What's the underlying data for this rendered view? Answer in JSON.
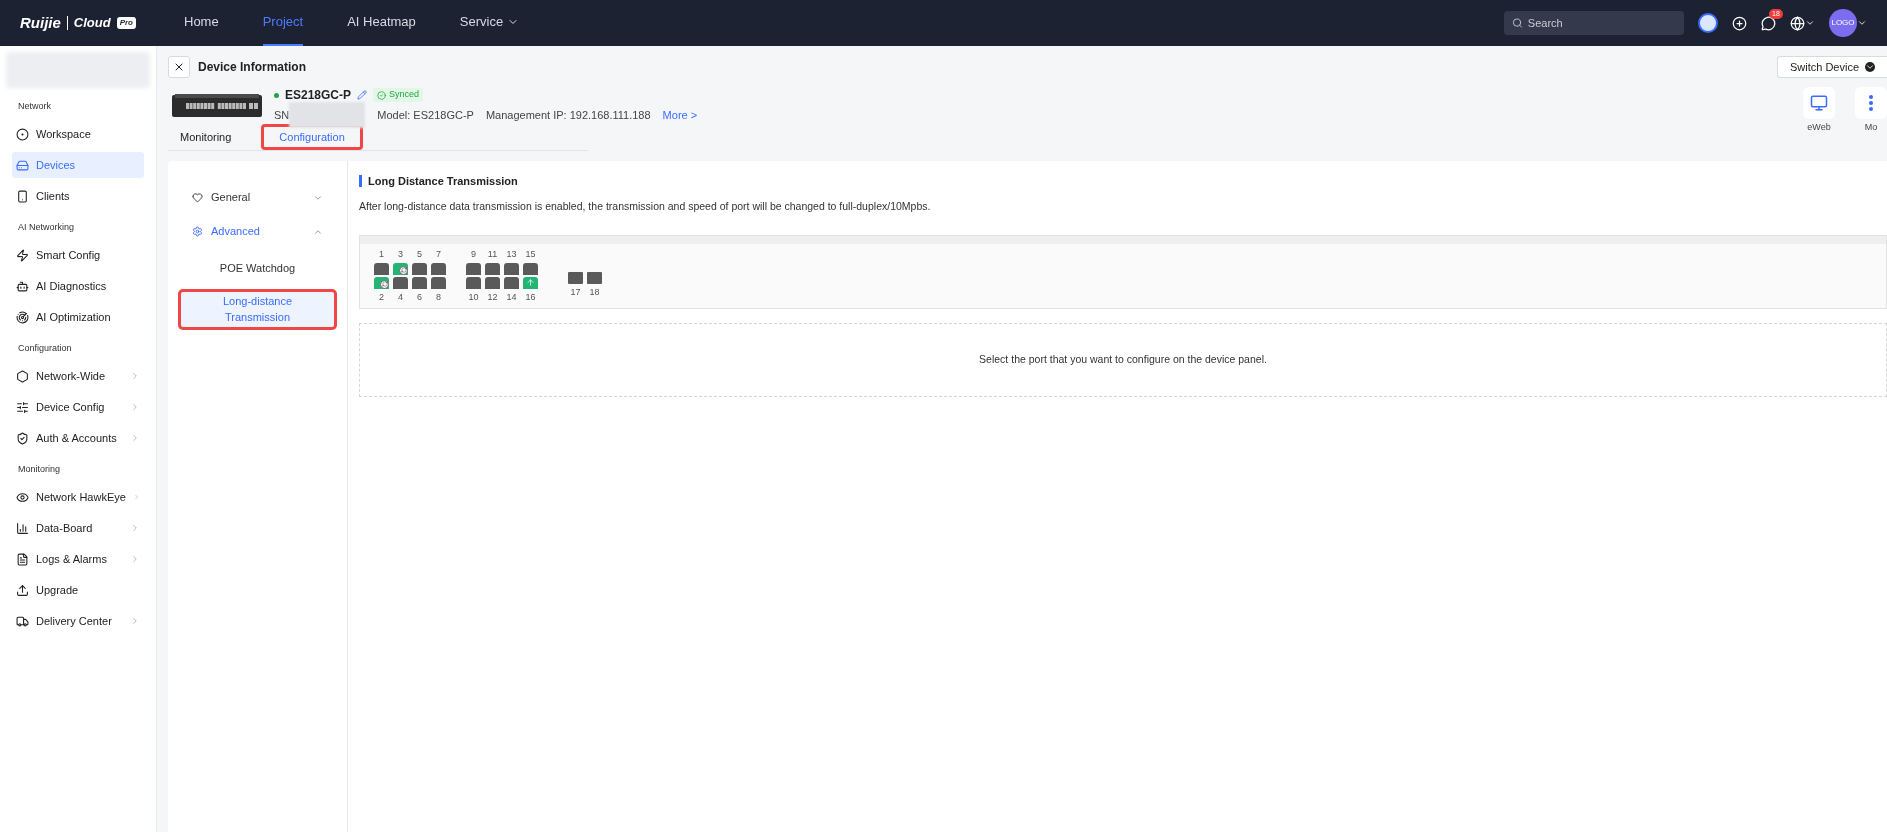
{
  "topbar": {
    "logo": "Ruijie",
    "logo_product": "Cloud",
    "logo_badge": "Pro",
    "nav": [
      {
        "label": "Home",
        "selected": false,
        "dropdown": false
      },
      {
        "label": "Project",
        "selected": true,
        "dropdown": false
      },
      {
        "label": "AI Heatmap",
        "selected": false,
        "dropdown": false
      },
      {
        "label": "Service",
        "selected": false,
        "dropdown": true
      }
    ],
    "search": {
      "placeholder": "Search"
    },
    "notification_count": "18",
    "avatar": "LOGO"
  },
  "sidebar": {
    "sections": [
      {
        "title": "Network",
        "items": [
          {
            "label": "Workspace",
            "selected": false,
            "expandable": false
          },
          {
            "label": "Devices",
            "selected": true,
            "expandable": false
          },
          {
            "label": "Clients",
            "selected": false,
            "expandable": false
          }
        ]
      },
      {
        "title": "AI Networking",
        "items": [
          {
            "label": "Smart Config",
            "selected": false,
            "expandable": false
          },
          {
            "label": "AI Diagnostics",
            "selected": false,
            "expandable": false
          },
          {
            "label": "AI Optimization",
            "selected": false,
            "expandable": false
          }
        ]
      },
      {
        "title": "Configuration",
        "items": [
          {
            "label": "Network-Wide",
            "selected": false,
            "expandable": true
          },
          {
            "label": "Device Config",
            "selected": false,
            "expandable": true
          },
          {
            "label": "Auth & Accounts",
            "selected": false,
            "expandable": true
          }
        ]
      },
      {
        "title": "Monitoring",
        "items": [
          {
            "label": "Network HawkEye",
            "selected": false,
            "expandable": true
          },
          {
            "label": "Data-Board",
            "selected": false,
            "expandable": true
          },
          {
            "label": "Logs & Alarms",
            "selected": false,
            "expandable": true
          },
          {
            "label": "Upgrade",
            "selected": false,
            "expandable": false
          },
          {
            "label": "Delivery Center",
            "selected": false,
            "expandable": true
          }
        ]
      }
    ]
  },
  "page": {
    "title": "Device Information",
    "switch_button": "Switch Device",
    "quick_actions": [
      {
        "label": "eWeb"
      },
      {
        "label": "Mo"
      }
    ]
  },
  "device": {
    "name": "ES218GC-P",
    "online": true,
    "status": "Synced",
    "sn_label": "SN",
    "model": "Model: ES218GC-P",
    "ip": "Management IP: 192.168.111.188",
    "more": "More >"
  },
  "tabs": [
    {
      "label": "Monitoring",
      "selected": false,
      "highlighted": false
    },
    {
      "label": "Configuration",
      "selected": true,
      "highlighted": true
    }
  ],
  "config_menu": [
    {
      "label": "General",
      "expanded": false,
      "selected": false
    },
    {
      "label": "Advanced",
      "expanded": true,
      "selected": true,
      "children": [
        {
          "label": "POE Watchdog",
          "selected": false,
          "highlighted": false
        },
        {
          "label": "Long-distance Transmission",
          "selected": true,
          "highlighted": true
        }
      ]
    }
  ],
  "section": {
    "title": "Long Distance Transmission",
    "description": "After long-distance data transmission is enabled, the transmission and speed of port will be changed to full-duplex/10Mpbs.",
    "empty_hint": "Select the port that you want to configure on the device panel."
  },
  "ports": [
    {
      "number": "1",
      "kind": "copper",
      "up": false,
      "loop": false,
      "uplink": false
    },
    {
      "number": "2",
      "kind": "copper",
      "up": true,
      "loop": true,
      "uplink": false
    },
    {
      "number": "3",
      "kind": "copper",
      "up": true,
      "loop": true,
      "uplink": false
    },
    {
      "number": "4",
      "kind": "copper",
      "up": false,
      "loop": false,
      "uplink": false
    },
    {
      "number": "5",
      "kind": "copper",
      "up": false,
      "loop": false,
      "uplink": false
    },
    {
      "number": "6",
      "kind": "copper",
      "up": false,
      "loop": false,
      "uplink": false
    },
    {
      "number": "7",
      "kind": "copper",
      "up": false,
      "loop": false,
      "uplink": false
    },
    {
      "number": "8",
      "kind": "copper",
      "up": false,
      "loop": false,
      "uplink": false
    },
    {
      "number": "9",
      "kind": "copper",
      "up": false,
      "loop": false,
      "uplink": false
    },
    {
      "number": "10",
      "kind": "copper",
      "up": false,
      "loop": false,
      "uplink": false
    },
    {
      "number": "11",
      "kind": "copper",
      "up": false,
      "loop": false,
      "uplink": false
    },
    {
      "number": "12",
      "kind": "copper",
      "up": false,
      "loop": false,
      "uplink": false
    },
    {
      "number": "13",
      "kind": "copper",
      "up": false,
      "loop": false,
      "uplink": false
    },
    {
      "number": "14",
      "kind": "copper",
      "up": false,
      "loop": false,
      "uplink": false
    },
    {
      "number": "15",
      "kind": "copper",
      "up": false,
      "loop": false,
      "uplink": false
    },
    {
      "number": "16",
      "kind": "copper",
      "up": true,
      "loop": false,
      "uplink": true
    },
    {
      "number": "17",
      "kind": "sfp",
      "up": false,
      "loop": false,
      "uplink": false
    },
    {
      "number": "18",
      "kind": "sfp",
      "up": false,
      "loop": false,
      "uplink": false
    }
  ]
}
